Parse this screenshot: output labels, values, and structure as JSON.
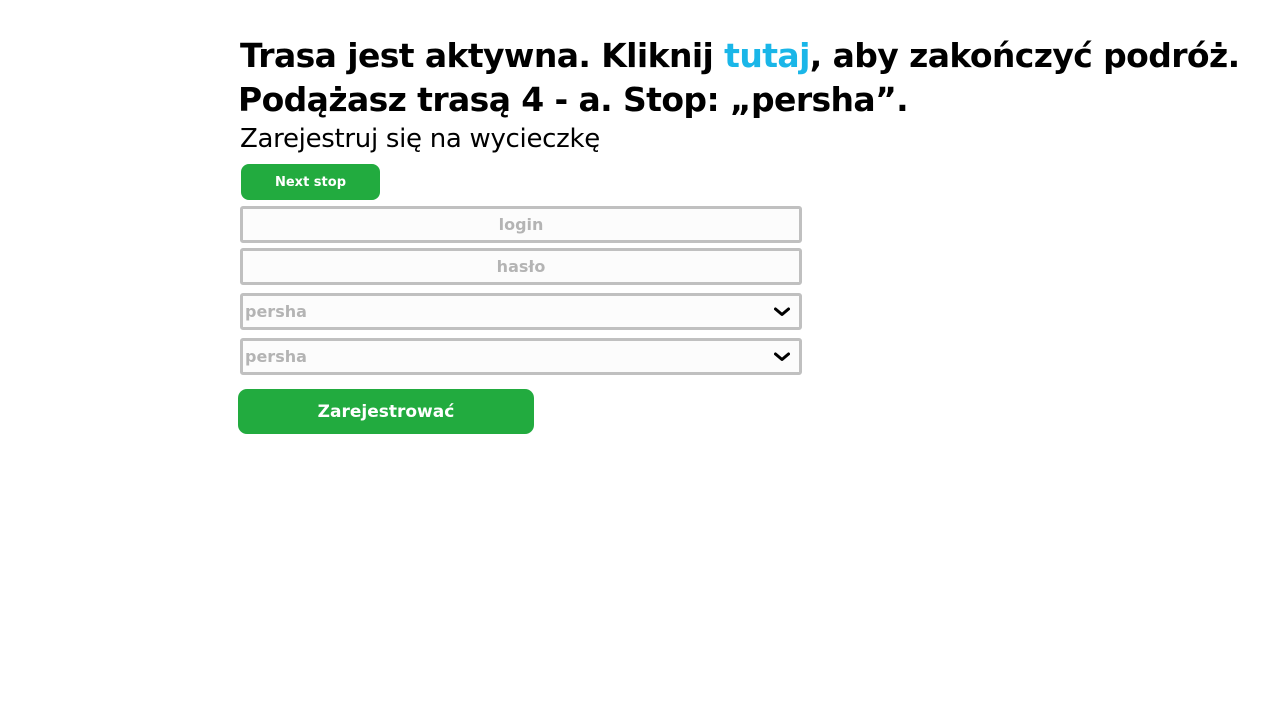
{
  "status": {
    "line1_prefix": "Trasa jest aktywna. Kliknij ",
    "line1_link": "tutaj",
    "line1_suffix": ", aby zakończyć podróż.",
    "line2": "Podążasz trasą 4 - a. Stop: „persha”."
  },
  "form": {
    "title": "Zarejestruj się na wycieczkę",
    "next_stop_label": "Next stop",
    "login_placeholder": "login",
    "password_placeholder": "hasło",
    "select1_value": "persha",
    "select2_value": "persha",
    "submit_label": "Zarejestrować"
  },
  "colors": {
    "link": "#1ab6e8",
    "button": "#22ab3f",
    "field_border": "#c0c0c0",
    "placeholder": "#b4b4b4"
  },
  "icons": {
    "select_arrow": "chevron-down-icon"
  }
}
